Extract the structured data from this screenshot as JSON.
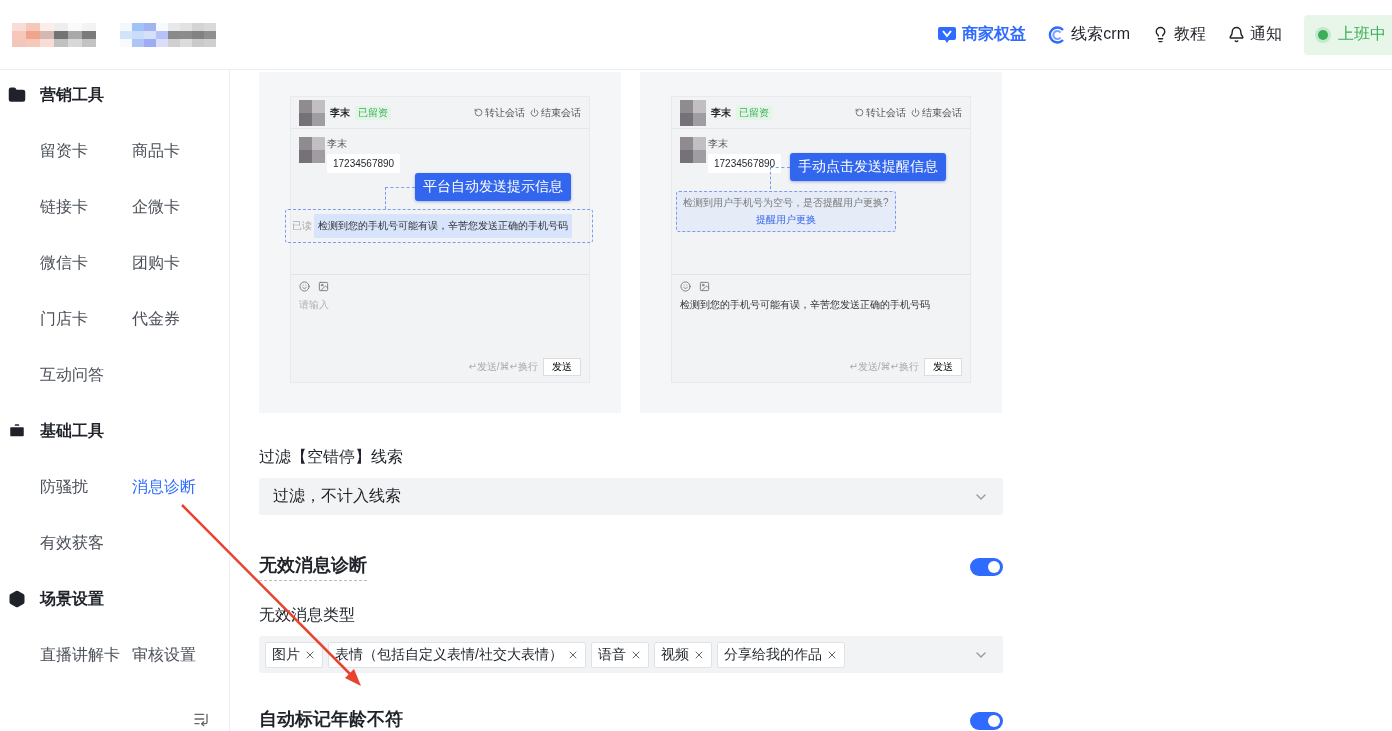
{
  "header": {
    "nav": [
      {
        "label": "商家权益",
        "kind": "benefit"
      },
      {
        "label": "线索crm",
        "kind": "crm"
      },
      {
        "label": "教程",
        "kind": "tutorial"
      },
      {
        "label": "通知",
        "kind": "notice"
      }
    ],
    "status": {
      "label": "上班中",
      "on": true
    }
  },
  "sidebar": {
    "sections": [
      {
        "title": "营销工具",
        "kind": "folder",
        "items": [
          {
            "label": "留资卡",
            "selected": false
          },
          {
            "label": "商品卡",
            "selected": false
          },
          {
            "label": "链接卡",
            "selected": false
          },
          {
            "label": "企微卡",
            "selected": false
          },
          {
            "label": "微信卡",
            "selected": false
          },
          {
            "label": "团购卡",
            "selected": false
          },
          {
            "label": "门店卡",
            "selected": false
          },
          {
            "label": "代金券",
            "selected": false
          },
          {
            "label": "互动问答",
            "selected": false
          }
        ]
      },
      {
        "title": "基础工具",
        "kind": "briefcase",
        "items": [
          {
            "label": "防骚扰",
            "selected": false
          },
          {
            "label": "消息诊断",
            "selected": true
          },
          {
            "label": "有效获客",
            "selected": false
          }
        ]
      },
      {
        "title": "场景设置",
        "kind": "settings",
        "items": [
          {
            "label": "直播讲解卡",
            "selected": false
          },
          {
            "label": "审核设置",
            "selected": false
          }
        ]
      }
    ]
  },
  "previews": [
    {
      "kind": "auto",
      "contact": {
        "name": "李末",
        "tag": "已留资"
      },
      "actions": [
        "转让会话",
        "结束会话"
      ],
      "message": {
        "name": "李末",
        "text": "17234567890"
      },
      "callout": "平台自动发送提示信息",
      "notice": {
        "read": "已读",
        "text": "检测到您的手机号可能有误，辛苦您发送正确的手机号码"
      },
      "input": {
        "placeholder": "请输入"
      },
      "hint": "↵发送/⌘↵换行",
      "send": "发送"
    },
    {
      "kind": "manual",
      "contact": {
        "name": "李末",
        "tag": "已留资"
      },
      "actions": [
        "转让会话",
        "结束会话"
      ],
      "message": {
        "name": "李末",
        "text": "17234567890"
      },
      "callout": "手动点击发送提醒信息",
      "notice": {
        "text": "检测到用户手机号为空号，是否提醒用户更换?",
        "link": "提醒用户更换"
      },
      "input": {
        "value": "检测到您的手机号可能有误，辛苦您发送正确的手机号码"
      },
      "hint": "↵发送/⌘↵换行",
      "send": "发送"
    }
  ],
  "filter": {
    "label": "过滤【空错停】线索",
    "value": "过滤，不计入线索"
  },
  "sections": [
    {
      "title": "无效消息诊断",
      "on": true,
      "field": {
        "label": "无效消息类型",
        "tags": [
          "图片",
          "表情（包括自定义表情/社交大表情）",
          "语音",
          "视频",
          "分享给我的作品"
        ]
      }
    },
    {
      "title": "自动标记年龄不符",
      "on": true
    }
  ]
}
